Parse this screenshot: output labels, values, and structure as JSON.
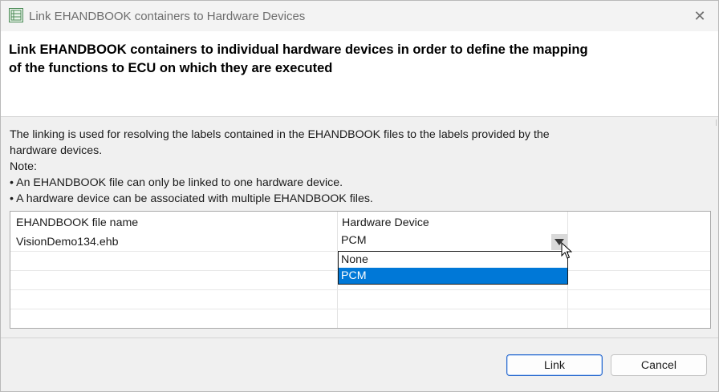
{
  "window": {
    "title": "Link EHANDBOOK containers to Hardware Devices",
    "close_glyph": "✕"
  },
  "header": {
    "title_line1": "Link EHANDBOOK containers to individual hardware devices in order to define the mapping",
    "title_line2": "of the functions to ECU on which they are executed"
  },
  "description": {
    "line1": "The linking is used for resolving the labels contained in the EHANDBOOK files to the labels provided by the",
    "line2": "hardware devices.",
    "line3": "Note:",
    "line4": "• An EHANDBOOK file can only be linked to one hardware device.",
    "line5": "• A hardware device can be associated with multiple EHANDBOOK files."
  },
  "table": {
    "columns": [
      "EHANDBOOK file name",
      "Hardware Device"
    ],
    "rows": [
      {
        "file": "VisionDemo134.ehb",
        "device": "PCM"
      }
    ]
  },
  "dropdown": {
    "options": [
      "None",
      "PCM"
    ],
    "selected": "PCM"
  },
  "buttons": {
    "link": "Link",
    "cancel": "Cancel"
  },
  "colors": {
    "selection": "#0078d7",
    "primary_border": "#2b6bcf"
  }
}
